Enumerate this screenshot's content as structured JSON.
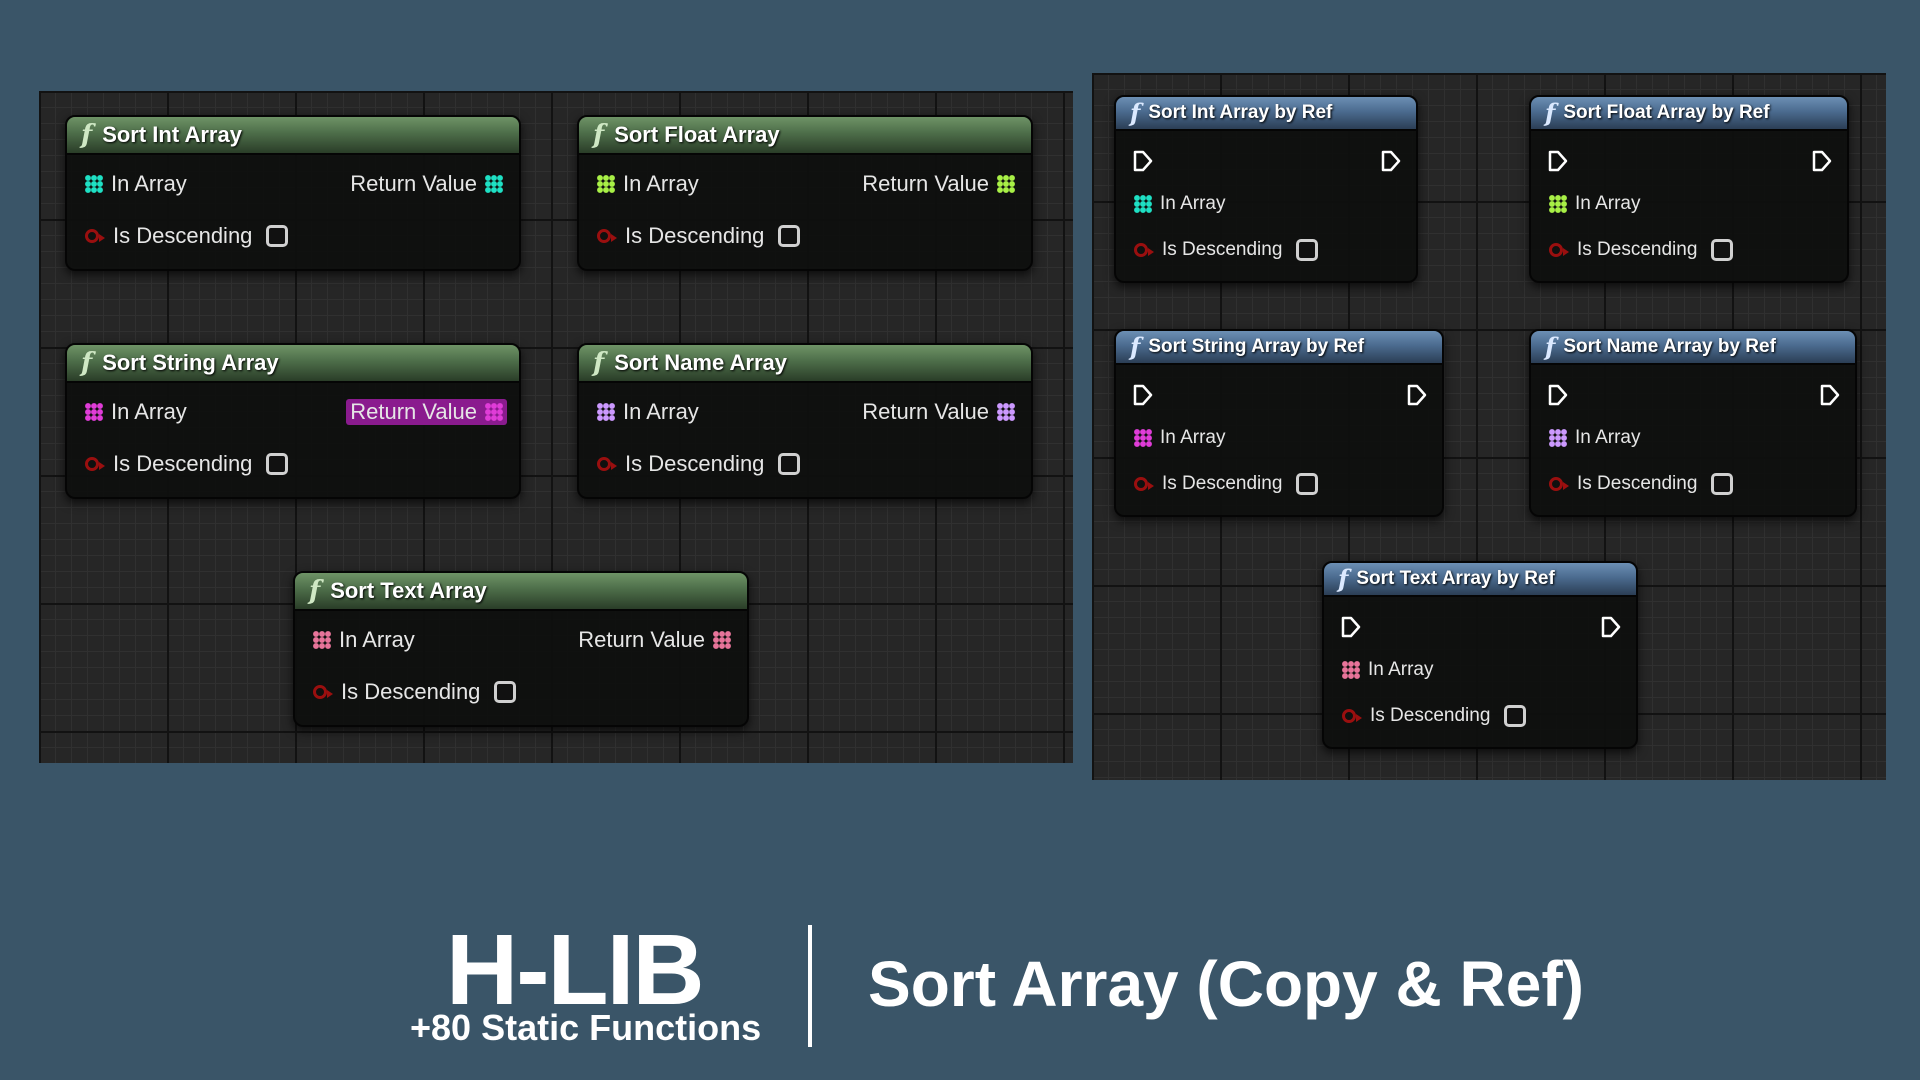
{
  "colors": {
    "background": "#3a5568",
    "pure_header": "#4d6d49",
    "ref_header": "#4b6b8f",
    "int_pin": "#1ee0c4",
    "float_pin": "#a8f046",
    "string_pin": "#e03cd8",
    "name_pin": "#cc99ff",
    "text_pin": "#e8749a",
    "bool_pin": "#9a0f0f",
    "highlight": "#8a1b8e"
  },
  "icons": {
    "function": "function-f-icon",
    "exec": "exec-arrow-icon",
    "array": "array-grid-icon",
    "bool": "bool-pin-icon"
  },
  "function_glyph": "f",
  "pins": {
    "in_array": "In Array",
    "return_value": "Return Value",
    "is_descending": "Is Descending"
  },
  "copy_nodes": [
    {
      "title": "Sort Int Array",
      "pin_color": "#1ee0c4",
      "return_highlighted": false
    },
    {
      "title": "Sort Float Array",
      "pin_color": "#a8f046",
      "return_highlighted": false
    },
    {
      "title": "Sort String Array",
      "pin_color": "#e03cd8",
      "return_highlighted": true
    },
    {
      "title": "Sort Name Array",
      "pin_color": "#cc99ff",
      "return_highlighted": false
    },
    {
      "title": "Sort Text Array",
      "pin_color": "#e8749a",
      "return_highlighted": false
    }
  ],
  "ref_nodes": [
    {
      "title": "Sort Int Array by Ref",
      "pin_color": "#1ee0c4"
    },
    {
      "title": "Sort Float Array by Ref",
      "pin_color": "#a8f046"
    },
    {
      "title": "Sort String Array by Ref",
      "pin_color": "#e03cd8"
    },
    {
      "title": "Sort Name Array by Ref",
      "pin_color": "#cc99ff"
    },
    {
      "title": "Sort Text Array by Ref",
      "pin_color": "#e8749a"
    }
  ],
  "footer": {
    "brand": "H-LIB",
    "subtitle": "+80 Static Functions",
    "heading": "Sort Array (Copy & Ref)"
  }
}
